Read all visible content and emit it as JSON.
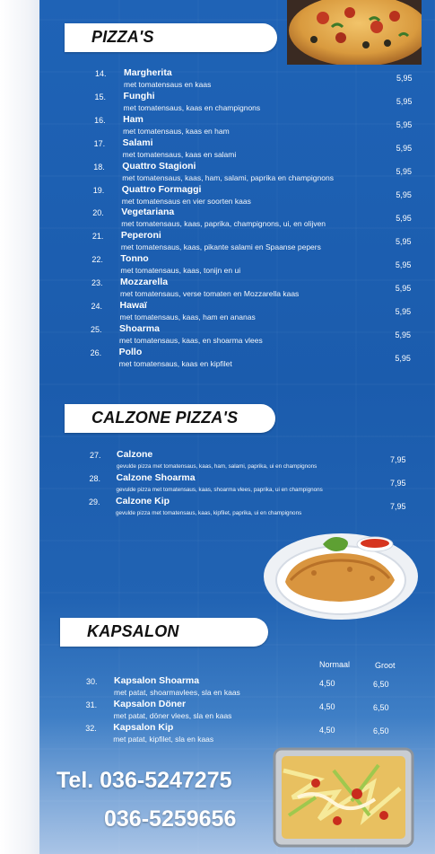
{
  "sections": {
    "pizzas": {
      "title": "PIZZA'S",
      "items": [
        {
          "num": "14.",
          "name": "Margherita",
          "desc": "met tomatensaus en kaas",
          "price": "5,95"
        },
        {
          "num": "15.",
          "name": "Funghi",
          "desc": "met tomatensaus, kaas en champignons",
          "price": "5,95"
        },
        {
          "num": "16.",
          "name": "Ham",
          "desc": "met tomatensaus, kaas en ham",
          "price": "5,95"
        },
        {
          "num": "17.",
          "name": "Salami",
          "desc": "met tomatensaus, kaas en salami",
          "price": "5,95"
        },
        {
          "num": "18.",
          "name": "Quattro Stagioni",
          "desc": "met tomatensaus, kaas, ham, salami, paprika en champignons",
          "price": "5,95"
        },
        {
          "num": "19.",
          "name": "Quattro Formaggi",
          "desc": "met tomatensaus en vier soorten kaas",
          "price": "5,95"
        },
        {
          "num": "20.",
          "name": "Vegetariana",
          "desc": "met tomatensaus, kaas, paprika, champignons, ui, en olijven",
          "price": "5,95"
        },
        {
          "num": "21.",
          "name": "Peperoni",
          "desc": "met tomatensaus, kaas, pikante salami en Spaanse pepers",
          "price": "5,95"
        },
        {
          "num": "22.",
          "name": "Tonno",
          "desc": "met tomatensaus, kaas, tonijn en ui",
          "price": "5,95"
        },
        {
          "num": "23.",
          "name": "Mozzarella",
          "desc": "met tomatensaus, verse tomaten en Mozzarella kaas",
          "price": "5,95"
        },
        {
          "num": "24.",
          "name": "Hawaï",
          "desc": "met tomatensaus, kaas, ham en ananas",
          "price": "5,95"
        },
        {
          "num": "25.",
          "name": "Shoarma",
          "desc": "met tomatensaus, kaas, en shoarma vlees",
          "price": "5,95"
        },
        {
          "num": "26.",
          "name": "Pollo",
          "desc": "met tomatensaus, kaas en kipfilet",
          "price": "5,95"
        }
      ]
    },
    "calzone": {
      "title": "CALZONE PIZZA'S",
      "items": [
        {
          "num": "27.",
          "name": "Calzone",
          "desc": "gevulde pizza met tomatensaus, kaas, ham, salami, paprika, ui en champignons",
          "price": "7,95"
        },
        {
          "num": "28.",
          "name": "Calzone Shoarma",
          "desc": "gevulde pizza met tomatensaus, kaas, shoarma vlees, paprika, ui en champignons",
          "price": "7,95"
        },
        {
          "num": "29.",
          "name": "Calzone Kip",
          "desc": "gevulde pizza met tomatensaus, kaas, kipfilet, paprika, ui en champignons",
          "price": "7,95"
        }
      ]
    },
    "kapsalon": {
      "title": "KAPSALON",
      "col_normaal": "Normaal",
      "col_groot": "Groot",
      "items": [
        {
          "num": "30.",
          "name": "Kapsalon Shoarma",
          "desc": "met patat, shoarmavlees, sla en kaas",
          "normaal": "4,50",
          "groot": "6,50"
        },
        {
          "num": "31.",
          "name": "Kapsalon Döner",
          "desc": "met patat, döner vlees, sla en kaas",
          "normaal": "4,50",
          "groot": "6,50"
        },
        {
          "num": "32.",
          "name": "Kapsalon Kip",
          "desc": "met patat, kipfilet, sla en kaas",
          "normaal": "4,50",
          "groot": "6,50"
        }
      ]
    }
  },
  "contact": {
    "phone1": "Tel. 036-5247275",
    "phone2": "036-5259656"
  },
  "colors": {
    "panel_blue": "#1f63b6",
    "band_white": "#ffffff"
  }
}
